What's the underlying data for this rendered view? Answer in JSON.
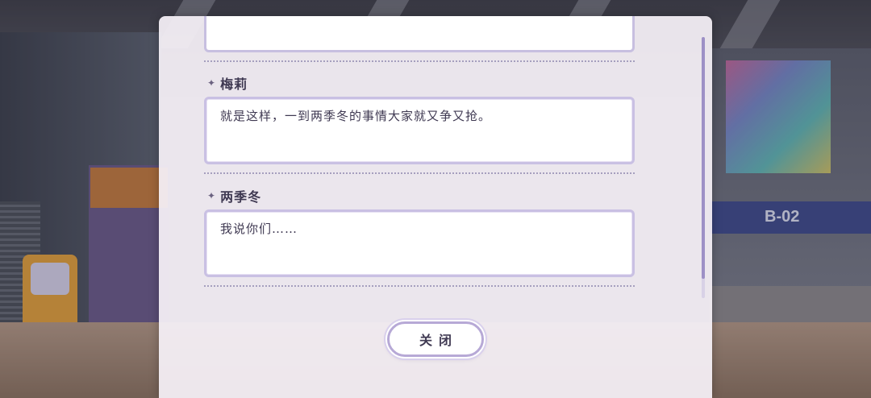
{
  "background": {
    "sign_text": "B-02"
  },
  "dialog": {
    "entries": [
      {
        "speaker": "梅莉",
        "text": "就是这样，一到两季冬的事情大家就又争又抢。"
      },
      {
        "speaker": "两季冬",
        "text": "我说你们……"
      }
    ],
    "close_label": "关闭"
  },
  "colors": {
    "panel": "#f6f1f7",
    "border": "#c9c0e3",
    "text": "#3f3952",
    "scroll_thumb": "#9d90c6"
  },
  "icons": {
    "speaker_marker": "sparkle-star-icon"
  }
}
